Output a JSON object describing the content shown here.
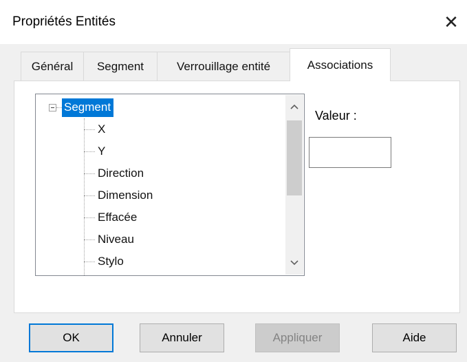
{
  "window": {
    "title": "Propriétés Entités",
    "close_glyph": "✕"
  },
  "tabs": [
    {
      "label": "Général"
    },
    {
      "label": "Segment"
    },
    {
      "label": "Verrouillage entité"
    },
    {
      "label": "Associations",
      "active": true
    }
  ],
  "tree": {
    "root_label": "Segment",
    "children": [
      {
        "label": "X"
      },
      {
        "label": "Y"
      },
      {
        "label": "Direction"
      },
      {
        "label": "Dimension"
      },
      {
        "label": "Effacée"
      },
      {
        "label": "Niveau"
      },
      {
        "label": "Stylo"
      }
    ],
    "scroll_up": "^",
    "scroll_down": "v"
  },
  "valeur": {
    "label": "Valeur :",
    "value": ""
  },
  "buttons": {
    "ok": "OK",
    "annuler": "Annuler",
    "appliquer": "Appliquer",
    "aide": "Aide"
  },
  "colors": {
    "selection": "#0078d7",
    "client_bg": "#f0f0f0",
    "default_border": "#0078d7"
  }
}
